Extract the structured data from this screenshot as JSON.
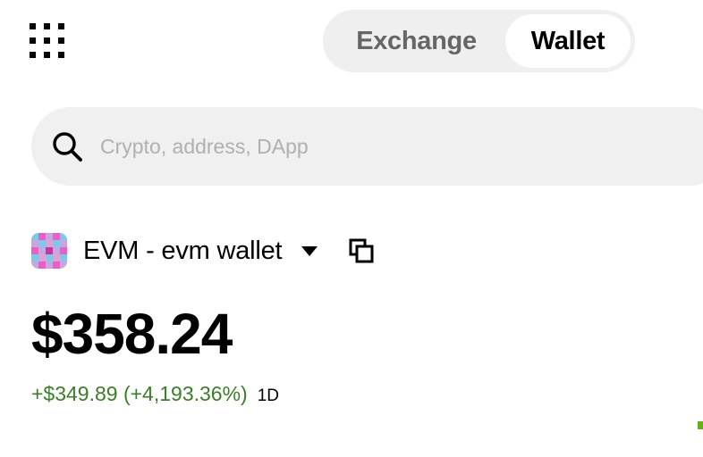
{
  "header": {
    "menu_icon": "grid-dots-icon",
    "tabs": [
      {
        "label": "Exchange",
        "active": false
      },
      {
        "label": "Wallet",
        "active": true
      }
    ]
  },
  "search": {
    "placeholder": "Crypto, address, DApp",
    "value": "",
    "icon": "search-icon"
  },
  "wallet": {
    "name": "EVM - evm wallet",
    "dropdown_icon": "caret-down-icon",
    "copy_icon": "copy-icon",
    "avatar_icon": "pixel-avatar-icon"
  },
  "portfolio": {
    "balance": "$358.24",
    "change": "+$349.89 (+4,193.36%)",
    "period": "1D"
  },
  "colors": {
    "positive": "#3b7d2a",
    "segmented_bg": "#efefef",
    "search_bg": "#f0f0f0",
    "placeholder": "#b0b0b0",
    "spark": "#63b21b"
  }
}
